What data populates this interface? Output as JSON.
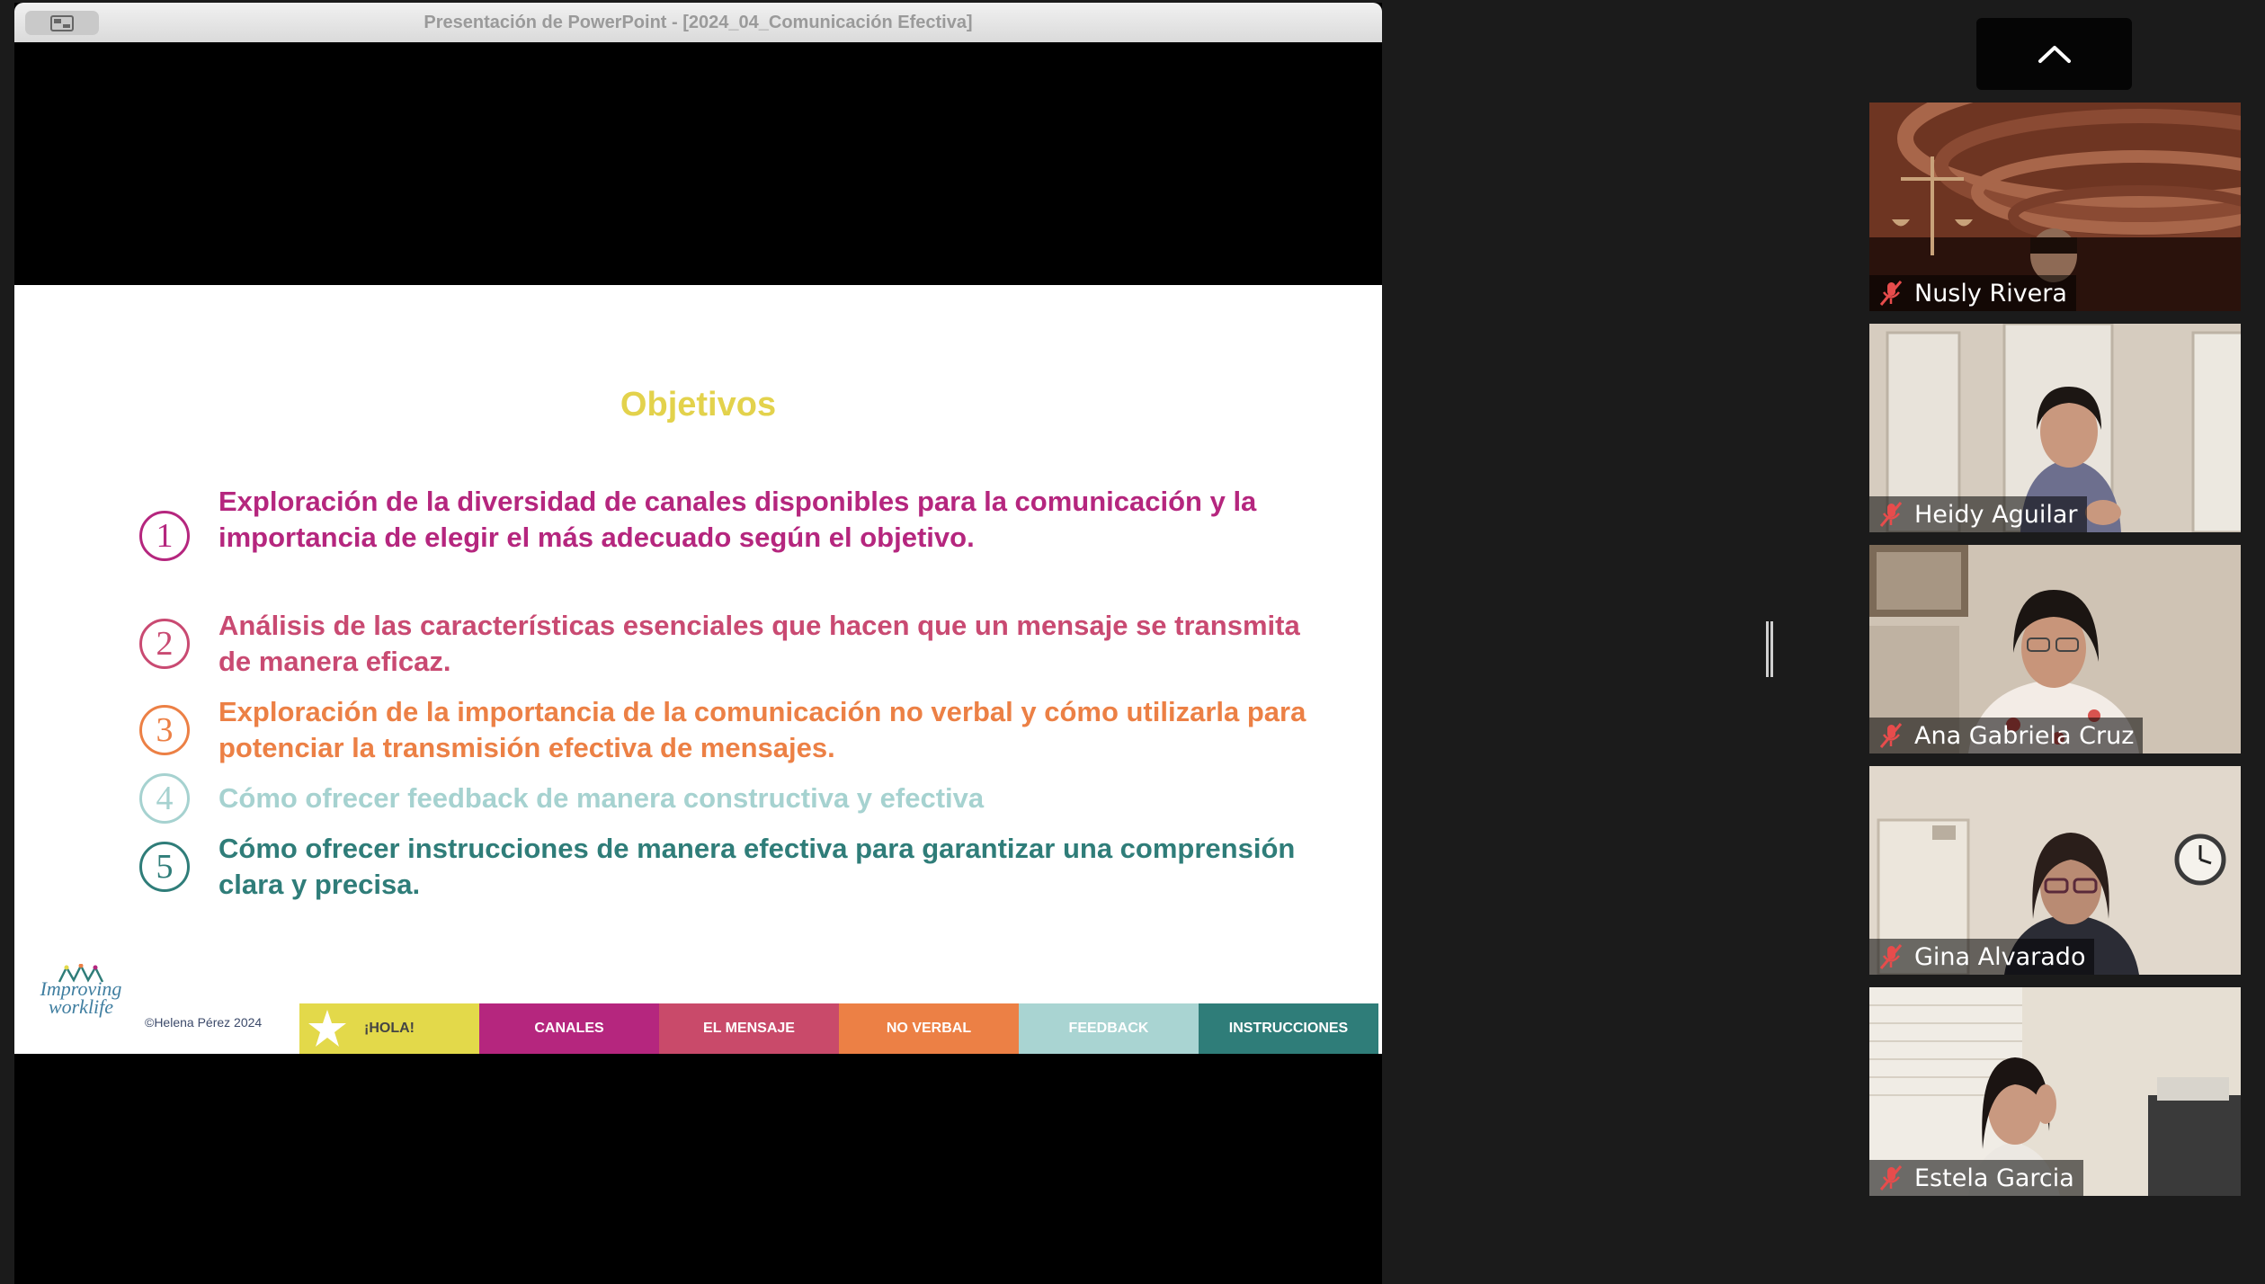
{
  "window": {
    "title": "Presentación de PowerPoint - [2024_04_Comunicación Efectiva]"
  },
  "slide": {
    "title": "Objetivos",
    "objectives": [
      {
        "number": "1",
        "text": "Exploración de la diversidad de canales disponibles para la comunicación y la importancia de elegir el más adecuado según el objetivo.",
        "color": "#b5267e"
      },
      {
        "number": "2",
        "text": "Análisis de las características esenciales que hacen que un mensaje se transmita de manera eficaz.",
        "color": "#c94a72"
      },
      {
        "number": "3",
        "text": "Exploración de la importancia de la comunicación no verbal y cómo utilizarla para potenciar la transmisión efectiva de mensajes.",
        "color": "#ec8045"
      },
      {
        "number": "4",
        "text": "Cómo ofrecer feedback de manera constructiva y efectiva",
        "color": "#a6d2d0"
      },
      {
        "number": "5",
        "text": "Cómo ofrecer instrucciones de manera efectiva para garantizar una comprensión clara y precisa.",
        "color": "#2f7d79"
      }
    ],
    "logo_text": "Improving worklife",
    "copyright": "©Helena Pérez 2024",
    "footer_tabs": [
      {
        "label": "¡HOLA!",
        "color": "#e3d94a"
      },
      {
        "label": "CANALES",
        "color": "#b5267e"
      },
      {
        "label": "EL MENSAJE",
        "color": "#c94a6a"
      },
      {
        "label": "NO VERBAL",
        "color": "#ec8045"
      },
      {
        "label": "FEEDBACK",
        "color": "#a9d4d2"
      },
      {
        "label": "INSTRUCCIONES",
        "color": "#2f7d79"
      }
    ]
  },
  "participants": [
    {
      "name": "Nusly Rivera",
      "muted": true,
      "icon": "muted-mic-icon"
    },
    {
      "name": "Heidy Aguilar",
      "muted": true,
      "icon": "muted-mic-icon"
    },
    {
      "name": "Ana Gabriela Cruz",
      "muted": true,
      "icon": "muted-mic-icon"
    },
    {
      "name": "Gina Alvarado",
      "muted": true,
      "icon": "muted-mic-icon"
    },
    {
      "name": "Estela Garcia",
      "muted": true,
      "icon": "muted-mic-icon"
    }
  ],
  "controls": {
    "collapse_icon": "chevron-up-icon",
    "view_icon": "share-view-icon"
  }
}
